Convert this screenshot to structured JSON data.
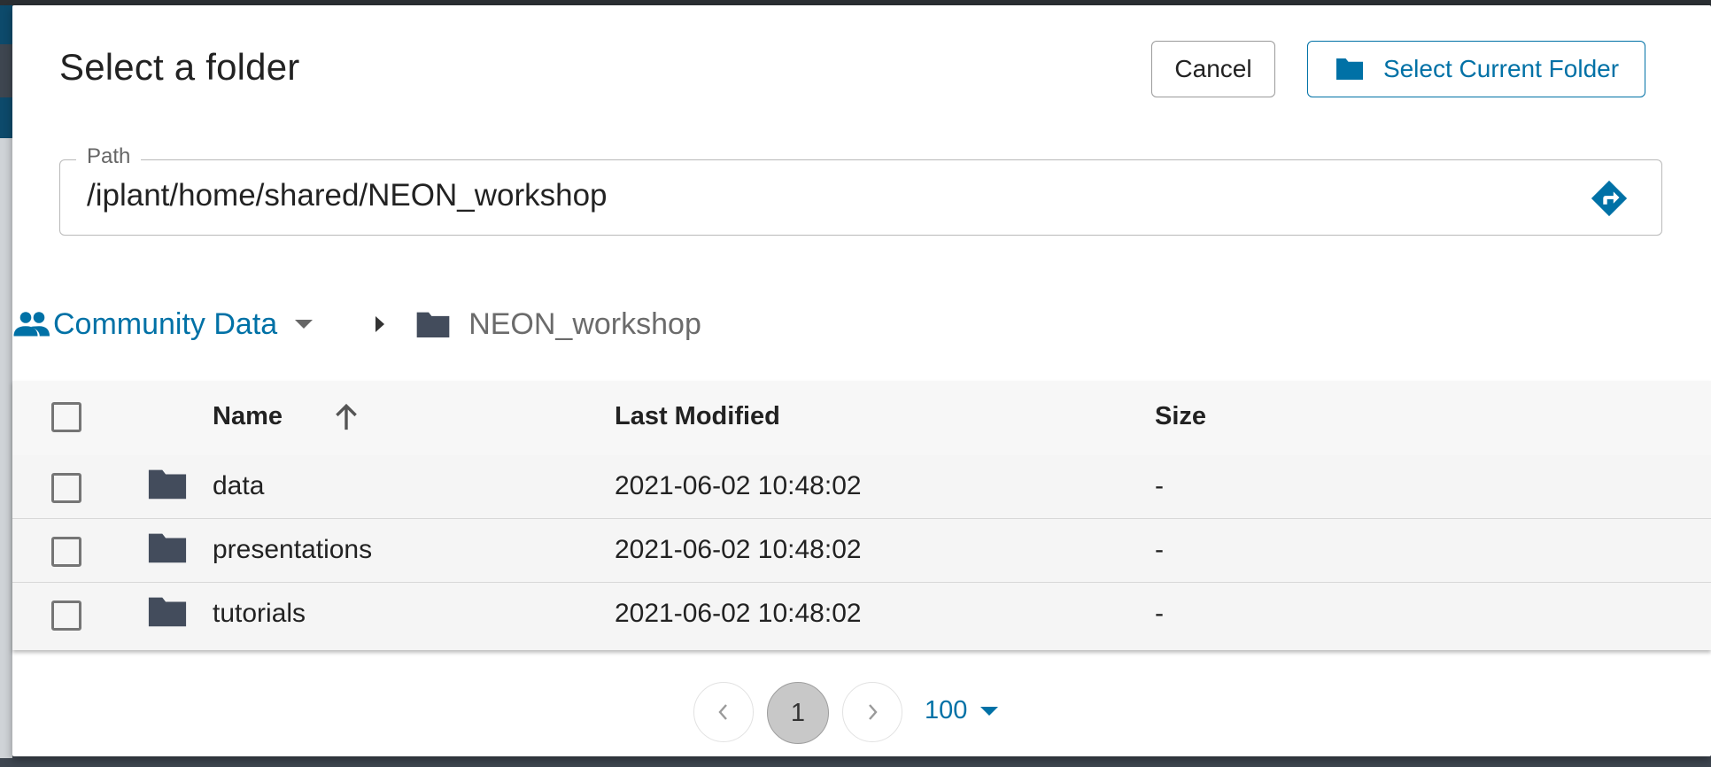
{
  "dialog": {
    "title": "Select a folder",
    "cancel_label": "Cancel",
    "select_label": "Select Current Folder"
  },
  "path": {
    "label": "Path",
    "value": "/iplant/home/shared/NEON_workshop"
  },
  "breadcrumb": {
    "root_label": "Community Data",
    "current": "NEON_workshop"
  },
  "table": {
    "columns": [
      "Name",
      "Last Modified",
      "Size"
    ],
    "sort": "Name ascending",
    "rows": [
      {
        "name": "data",
        "modified": "2021-06-02 10:48:02",
        "size": "-"
      },
      {
        "name": "presentations",
        "modified": "2021-06-02 10:48:02",
        "size": "-"
      },
      {
        "name": "tutorials",
        "modified": "2021-06-02 10:48:02",
        "size": "-"
      }
    ]
  },
  "pagination": {
    "current_page": "1",
    "per_page": "100"
  },
  "colors": {
    "accent": "#0071a6",
    "folder": "#434c5c"
  }
}
